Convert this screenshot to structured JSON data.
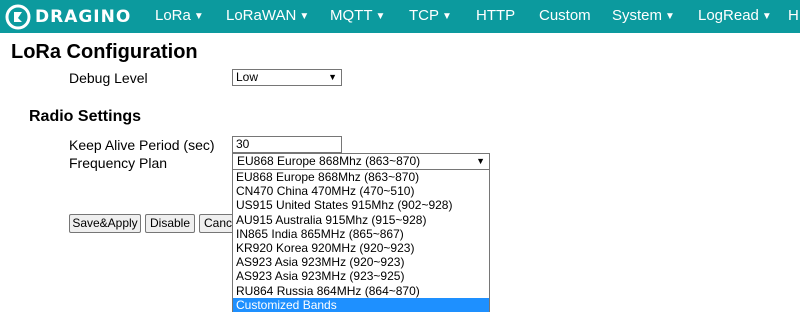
{
  "navbar": {
    "brand": "DRAGINO",
    "items": [
      {
        "label": "LoRa",
        "caret": "▼"
      },
      {
        "label": "LoRaWAN",
        "caret": "▼"
      },
      {
        "label": "MQTT",
        "caret": "▼"
      },
      {
        "label": "TCP",
        "caret": "▼"
      },
      {
        "label": "HTTP",
        "caret": ""
      },
      {
        "label": "Custom",
        "caret": ""
      },
      {
        "label": "System",
        "caret": "▼"
      },
      {
        "label": "LogRead",
        "caret": "▼"
      },
      {
        "label": "H",
        "caret": ""
      }
    ]
  },
  "page": {
    "title": "LoRa Configuration",
    "debug_level_label": "Debug Level",
    "debug_level_value": "Low",
    "radio_section_title": "Radio Settings",
    "keep_alive_label": "Keep Alive Period (sec)",
    "keep_alive_value": "30",
    "frequency_plan_label": "Frequency Plan",
    "frequency_plan_value": "EU868 Europe 868Mhz (863~870)"
  },
  "frequency_options": [
    "EU868 Europe 868Mhz (863~870)",
    "CN470 China 470MHz (470~510)",
    "US915 United States 915Mhz (902~928)",
    "AU915 Australia 915Mhz (915~928)",
    "IN865 India 865MHz (865~867)",
    "KR920 Korea 920MHz (920~923)",
    "AS923 Asia 923MHz (920~923)",
    "AS923 Asia 923MHz (923~925)",
    "RU864 Russia 864MHz (864~870)",
    "Customized Bands"
  ],
  "frequency_highlighted_index": 9,
  "buttons": {
    "save_apply": "Save&Apply",
    "disable": "Disable",
    "cancel": "Cance"
  },
  "colors": {
    "navbar": "#0c9a9e",
    "highlight": "#1e90ff"
  },
  "icons": {
    "logo": "dragino-logo-icon",
    "dropdown_arrow": "▼"
  }
}
